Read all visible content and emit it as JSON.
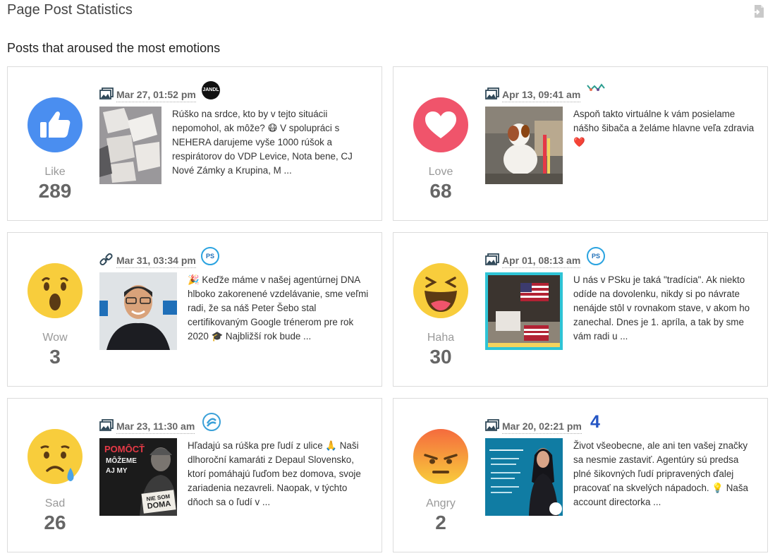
{
  "header": {
    "title": "Page Post Statistics",
    "export_icon": "export-icon"
  },
  "section": {
    "title": "Posts that aroused the most emotions"
  },
  "colors": {
    "like": "#4a8ef0",
    "love": "#f0546b",
    "emoji": "#f8cd3c",
    "angry_top": "#f56b3d",
    "label": "#999999",
    "count": "#666666"
  },
  "cards": [
    {
      "reaction": "Like",
      "count": "289",
      "icon": "like-icon",
      "post_type": "photo-icon",
      "date": "Mar 27, 01:52 pm",
      "page_avatar": "JANDL",
      "text": "Rúško na srdce, kto by v tejto situácii nepomohol, ak môže? 😷 V spolupráci s NEHERA darujeme vyše 1000 rúšok a respirátorov do VDP Levice, Nota bene, CJ Nové Zámky a Krupina, M ..."
    },
    {
      "reaction": "Love",
      "count": "68",
      "icon": "love-icon",
      "post_type": "photo-icon",
      "date": "Apr 13, 09:41 am",
      "page_avatar": "",
      "text": "Aspoň takto virtuálne k vám posielame nášho šibača a želáme hlavne veľa zdravia ❤️"
    },
    {
      "reaction": "Wow",
      "count": "3",
      "icon": "wow-icon",
      "post_type": "link-icon",
      "date": "Mar 31, 03:34 pm",
      "page_avatar": "PS",
      "text": "🎉 Keďže máme v našej agentúrnej DNA hlboko zakorenené vzdelávanie, sme veľmi radi, že sa náš Peter Šebo stal certifikovaným Google trénerom pre rok 2020 🎓 Najbližší rok bude ..."
    },
    {
      "reaction": "Haha",
      "count": "30",
      "icon": "haha-icon",
      "post_type": "photo-icon",
      "date": "Apr 01, 08:13 am",
      "page_avatar": "PS",
      "text": "U nás v PSku je taká \"tradícia\". Ak niekto odíde na dovolenku, nikdy si po návrate nenájde stôl v rovnakom stave, v akom ho zanechal. Dnes je 1. apríla, a tak by sme vám radi u ..."
    },
    {
      "reaction": "Sad",
      "count": "26",
      "icon": "sad-icon",
      "post_type": "photo-icon",
      "date": "Mar 23, 11:30 am",
      "page_avatar": "",
      "thumb_text": {
        "line1": "POMÔCŤ",
        "line2": "MÔŽEME",
        "line3": "AJ MY",
        "sign1": "NIE SOM",
        "sign2": "DOMA"
      },
      "text": "Hľadajú sa rúška pre ľudí z ulice 🙏 Naši dlhoroční kamaráti z Depaul Slovensko, ktorí pomáhajú ľuďom bez domova, svoje zariadenia nezavreli. Naopak, v týchto dňoch sa o ľudí v ..."
    },
    {
      "reaction": "Angry",
      "count": "2",
      "icon": "angry-icon",
      "post_type": "photo-icon",
      "date": "Mar 20, 02:21 pm",
      "page_avatar": "4",
      "text": "Život všeobecne, ale ani ten vašej značky sa nesmie zastaviť. Agentúry sú predsa plné šikovných ľudí pripravených ďalej pracovať na skvelých nápadoch. 💡 Naša account directorka ..."
    }
  ]
}
